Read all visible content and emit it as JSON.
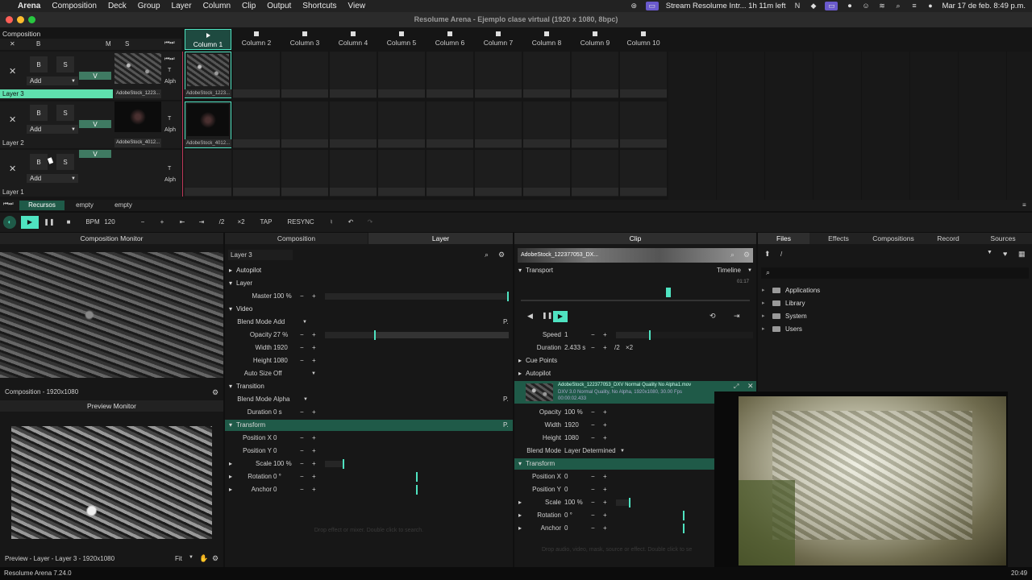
{
  "menubar": {
    "app": "Arena",
    "items": [
      "Composition",
      "Deck",
      "Group",
      "Layer",
      "Column",
      "Clip",
      "Output",
      "Shortcuts",
      "View"
    ],
    "status_stream": "Stream Resolume Intr... 1h 11m left",
    "datetime": "Mar 17 de feb.  8:49 p.m."
  },
  "window": {
    "title": "Resolume Arena - Ejemplo clase virtual  (1920 x 1080, 8bpc)"
  },
  "composition": {
    "label": "Composition",
    "header_buttons": {
      "close": "✕",
      "bypass": "B",
      "master": "M",
      "solo": "S"
    },
    "columns": [
      "Column 1",
      "Column 2",
      "Column 3",
      "Column 4",
      "Column 5",
      "Column 6",
      "Column 7",
      "Column 8",
      "Column 9",
      "Column 10"
    ],
    "layers": [
      {
        "name": "Layer 3",
        "bypass": "B",
        "solo": "S",
        "blend": "Add",
        "video": "V",
        "t": "T",
        "alpha": "Alph",
        "clip_label": "AdobeStock_1223...",
        "active": true
      },
      {
        "name": "Layer 2",
        "bypass": "B",
        "solo": "S",
        "blend": "Add",
        "video": "V",
        "t": "T",
        "alpha": "Alph",
        "clip_label": "AdobeStock_4012...",
        "active": false
      },
      {
        "name": "Layer 1",
        "bypass": "B",
        "solo": "S",
        "blend": "Add",
        "video": "V",
        "t": "T",
        "alpha": "Alph",
        "clip_label": "",
        "active": false
      }
    ],
    "decks": [
      "Recursos",
      "empty",
      "empty"
    ]
  },
  "transport": {
    "bpm_label": "BPM",
    "bpm": "120",
    "minus": "−",
    "plus": "+",
    "half": "/2",
    "double": "×2",
    "tap": "TAP",
    "resync": "RESYNC"
  },
  "monitors": {
    "comp_title": "Composition Monitor",
    "comp_caption": "Composition - 1920x1080",
    "preview_title": "Preview Monitor",
    "preview_caption": "Preview - Layer - Layer 3 - 1920x1080",
    "fit": "Fit"
  },
  "tabs_mid": [
    "Composition",
    "Layer"
  ],
  "layer_panel": {
    "name": "Layer 3",
    "autopilot": "Autopilot",
    "layer_section": "Layer",
    "master_label": "Master",
    "master": "100 %",
    "video_section": "Video",
    "blend_label": "Blend Mode",
    "blend": "Add",
    "opacity_label": "Opacity",
    "opacity": "27 %",
    "width_label": "Width",
    "width": "1920",
    "height_label": "Height",
    "height": "1080",
    "autosize_label": "Auto Size",
    "autosize": "Off",
    "transition_section": "Transition",
    "tblend_label": "Blend Mode",
    "tblend": "Alpha",
    "duration_label": "Duration",
    "duration": "0 s",
    "transform_section": "Transform",
    "posx_label": "Position X",
    "posx": "0",
    "posy_label": "Position Y",
    "posy": "0",
    "scale_label": "Scale",
    "scale": "100 %",
    "rotation_label": "Rotation",
    "rotation": "0 °",
    "anchor_label": "Anchor",
    "anchor": "0",
    "drop_hint": "Drop effect or mixer. Double click to search.",
    "p_badge": "P."
  },
  "clip_panel": {
    "tab": "Clip",
    "clip_name": "AdobeStock_122377053_DX...",
    "transport_section": "Transport",
    "timeline": "Timeline",
    "time": "01:17",
    "speed_label": "Speed",
    "speed": "1",
    "duration_label": "Duration",
    "duration": "2.433 s",
    "half": "/2",
    "double": "×2",
    "cue_points": "Cue Points",
    "autopilot": "Autopilot",
    "file_line1": "AdobeStock_122377053_DXV Normal Quality No Alpha1.mov",
    "file_line2": "DXV 3.0 Normal Quality, No Alpha, 1920x1080, 30.00 Fps",
    "file_line3": "00:00:02.433",
    "opacity_label": "Opacity",
    "opacity": "100 %",
    "width_label": "Width",
    "width": "1920",
    "height_label": "Height",
    "height": "1080",
    "blend_label": "Blend Mode",
    "blend": "Layer Determined",
    "transform_section": "Transform",
    "posx_label": "Position X",
    "posx": "0",
    "posy_label": "Position Y",
    "posy": "0",
    "scale_label": "Scale",
    "scale": "100 %",
    "rotation_label": "Rotation",
    "rotation": "0 °",
    "anchor_label": "Anchor",
    "anchor": "0",
    "drop_hint": "Drop audio, video, mask, source or effect. Double click to se"
  },
  "browser": {
    "tabs": [
      "Files",
      "Effects",
      "Compositions",
      "Record",
      "Sources"
    ],
    "path": "/",
    "folders": [
      "Applications",
      "Library",
      "System",
      "Users"
    ]
  },
  "statusbar": {
    "version": "Resolume Arena 7.24.0",
    "time": "20:49"
  },
  "colors": {
    "accent": "#4fe3c1",
    "green_section": "#1f5a48",
    "layer_active": "#5fe0ae"
  }
}
